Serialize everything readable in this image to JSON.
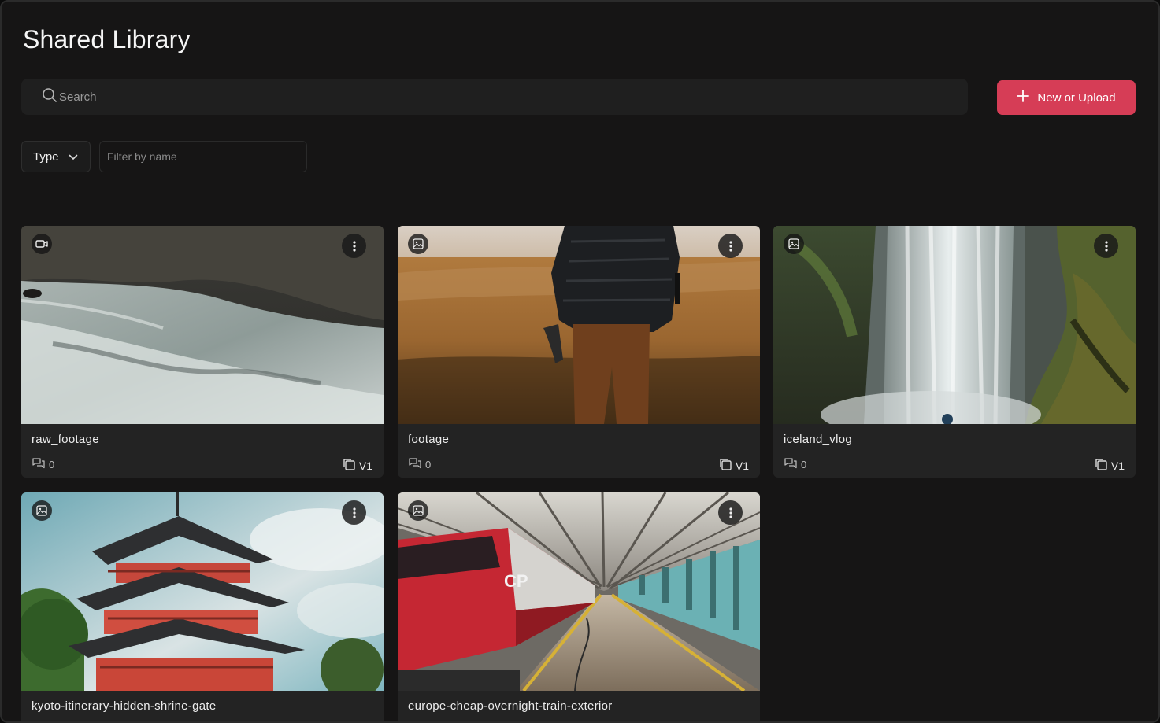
{
  "page": {
    "title": "Shared Library"
  },
  "search": {
    "placeholder": "Search"
  },
  "actions": {
    "new_upload_label": "New or Upload"
  },
  "filters": {
    "type_label": "Type",
    "name_placeholder": "Filter by name"
  },
  "colors": {
    "accent": "#d63d56",
    "background": "#161515",
    "card": "#232323"
  },
  "assets": [
    {
      "name": "raw_footage",
      "type_icon": "video-camera-icon",
      "comments": "0",
      "version": "V1",
      "scene": "river rapids"
    },
    {
      "name": "footage",
      "type_icon": "image-icon",
      "comments": "0",
      "version": "V1",
      "scene": "person in golden field"
    },
    {
      "name": "iceland_vlog",
      "type_icon": "image-icon",
      "comments": "0",
      "version": "V1",
      "scene": "waterfall"
    },
    {
      "name": "kyoto-itinerary-hidden-shrine-gate",
      "type_icon": "image-icon",
      "scene": "red pagoda"
    },
    {
      "name": "europe-cheap-overnight-train-exterior",
      "type_icon": "image-icon",
      "scene": "red train in station"
    }
  ]
}
